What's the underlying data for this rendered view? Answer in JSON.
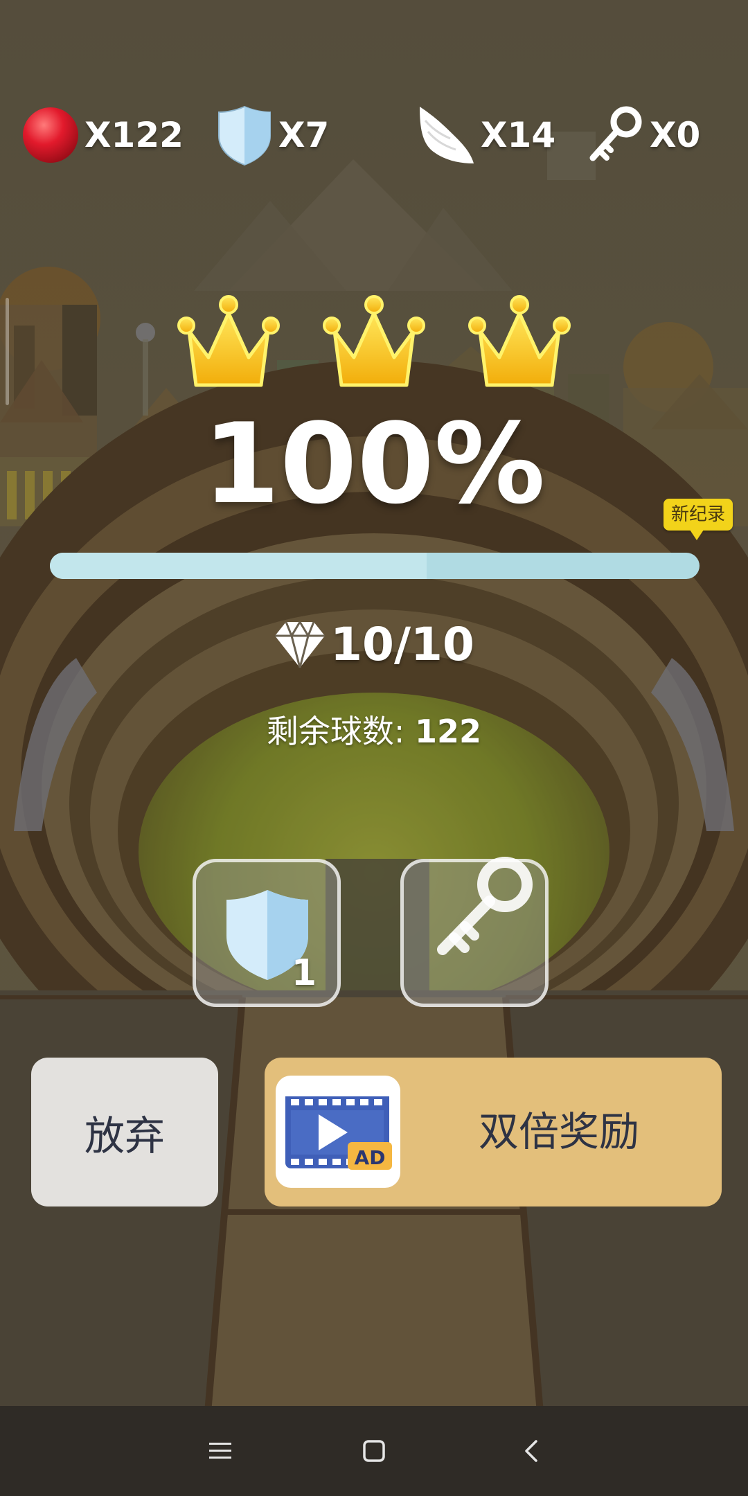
{
  "resources": {
    "balls": {
      "label": "X122",
      "icon": "red-ball-icon"
    },
    "shields": {
      "label": "X7",
      "icon": "shield-icon"
    },
    "wings": {
      "label": "X14",
      "icon": "wing-icon"
    },
    "keys": {
      "label": "X0",
      "icon": "key-icon"
    }
  },
  "result": {
    "crowns_earned": 3,
    "crowns_total": 3,
    "percent_text": "100%",
    "record_badge": "新纪录",
    "progress": 1.0,
    "gems": "10/10",
    "remaining_label": "剩余球数:",
    "remaining_value": "122"
  },
  "items": [
    {
      "name": "shield",
      "icon": "shield-icon",
      "count": "1"
    },
    {
      "name": "key",
      "icon": "key-icon",
      "count": ""
    }
  ],
  "buttons": {
    "give_up": "放弃",
    "double_reward": "双倍奖励",
    "ad_icon": "ad-video-icon",
    "ad_badge": "AD"
  },
  "nav": {
    "menu_icon": "menu-icon",
    "home_icon": "home-icon",
    "back_icon": "back-icon"
  },
  "colors": {
    "button_giveup": "#e3e1de",
    "button_double": "#e3bf7b",
    "crown_gold": "#f7c51c",
    "progress_bar": "#b0dbe3",
    "record_badge": "#f2d31a"
  }
}
